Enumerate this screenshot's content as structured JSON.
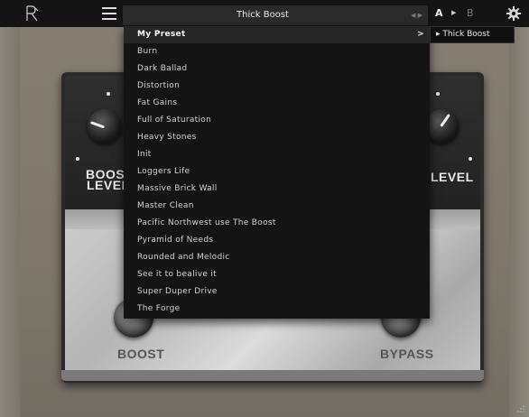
{
  "header": {
    "preset_name": "Thick Boost",
    "preset_nav_arrows": "◀ ▶",
    "ab_a": "A",
    "ab_arrow": "▶",
    "ab_b": "B",
    "icons": [
      "logo-icon",
      "hamburger-menu-icon",
      "gear-icon"
    ]
  },
  "menu": {
    "items": [
      {
        "label": "My Preset",
        "active": true,
        "submenu": true
      },
      {
        "label": "Burn"
      },
      {
        "label": "Dark Ballad"
      },
      {
        "label": "Distortion"
      },
      {
        "label": "Fat Gains"
      },
      {
        "label": "Full of Saturation"
      },
      {
        "label": "Heavy Stones"
      },
      {
        "label": "Init"
      },
      {
        "label": "Loggers Life"
      },
      {
        "label": "Massive Brick Wall"
      },
      {
        "label": "Master Clean"
      },
      {
        "label": "Pacific Northwest use The Boost"
      },
      {
        "label": "Pyramid of Needs"
      },
      {
        "label": "Rounded and Melodic"
      },
      {
        "label": "See it to bealive it"
      },
      {
        "label": "Super Duper Drive"
      },
      {
        "label": "The Forge"
      }
    ],
    "chevron": ">"
  },
  "submenu": {
    "item_label": "▸ Thick Boost"
  },
  "pedal": {
    "left_knob_label_line1": "BOOST",
    "left_knob_label_line2": "LEVEL",
    "right_knob_label": "LEVEL",
    "left_footswitch_label": "BOOST",
    "right_footswitch_label": "BYPASS"
  },
  "colors": {
    "topbar": "#141414",
    "menu_bg": "#141414",
    "menu_active": "#262626",
    "text": "#d4d4d4"
  }
}
